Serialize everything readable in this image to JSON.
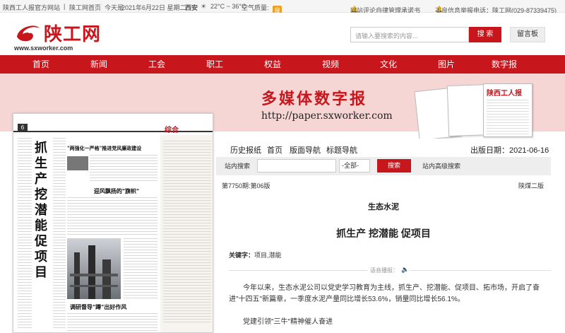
{
  "topbar": {
    "site_name": "陕西工人报官方网站",
    "sep": "|",
    "home": "陕工网首页",
    "today_label": "今天是",
    "date": "2021年6月22日 星期二",
    "city": "西安",
    "temp": "22°C ~ 36°C",
    "air_label": "空气质量:",
    "air_value": "良",
    "notice1": "网站评论自律管理承诺书",
    "notice2": "不良信息举报电话：陕工网(029-87339475)"
  },
  "header": {
    "logo_text": "陕工网",
    "logo_url": "www.sxworker.com",
    "search_placeholder": "请输入要搜索的内容...",
    "search_button": "搜 索",
    "message_button": "留言板"
  },
  "nav": {
    "items": [
      "首页",
      "新闻",
      "工会",
      "职工",
      "权益",
      "视频",
      "文化",
      "图片",
      "数字报"
    ]
  },
  "banner": {
    "title": "多媒体数字报",
    "url": "http://paper.sxworker.com",
    "paper_title": "陕西工人报"
  },
  "newspaper": {
    "page_no": "6",
    "section": "综合",
    "vertical_title": "抓生产 挖潜能 促项目",
    "headlines": [
      "\"两强化一严格\"推进党风廉政建设",
      "迎风飘扬的\"旗帜\"",
      "调研督导\"蹲\"出好作风"
    ]
  },
  "reader": {
    "tabs": [
      "历史报纸",
      "首页",
      "版面导航",
      "标题导航"
    ],
    "date_label": "出版日期：",
    "date_value": "2021-06-16",
    "search_label": "站内搜索",
    "select_value": "-全部-",
    "search_button": "搜索",
    "advanced": "站内高级搜索",
    "edition": "第7750期:第06版",
    "page_name": "陕煤二版",
    "pre_title": "生态水泥",
    "title": "抓生产 挖潜能 促项目",
    "keywords_label": "关键字：",
    "keywords": "项目,潜能",
    "voice_label": "语音播报：",
    "paragraphs": [
      "今年以来，生态水泥公司以党史学习教育为主线，抓生产、挖潜能、促项目、拓市场，开启了奋进\"十四五\"新篇章，一季度水泥产量同比增长53.6%，销量同比增长56.1%。",
      "党建引领\"三牛\"精神催人奋进"
    ]
  },
  "colors": {
    "brand_red": "#c8161d",
    "banner_pink": "#f6d6d4"
  }
}
